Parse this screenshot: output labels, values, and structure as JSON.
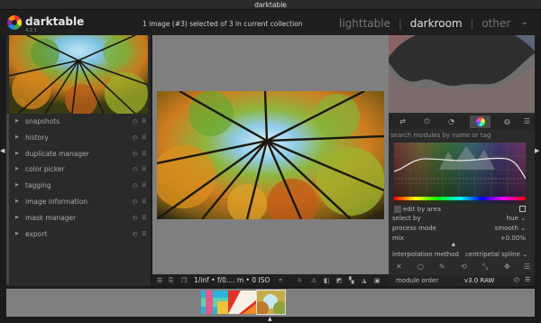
{
  "window": {
    "title": "darktable"
  },
  "app": {
    "name": "darktable",
    "version": "4.2.1"
  },
  "header": {
    "selection_info": "1 image (#3) selected of 3 in current collection",
    "views": [
      "lighttable",
      "darkroom",
      "other"
    ],
    "active_view": "darkroom",
    "separator": "|"
  },
  "left_modules": [
    {
      "label": "snapshots"
    },
    {
      "label": "history"
    },
    {
      "label": "duplicate manager"
    },
    {
      "label": "color picker"
    },
    {
      "label": "tagging"
    },
    {
      "label": "image information"
    },
    {
      "label": "mask manager"
    },
    {
      "label": "export"
    }
  ],
  "right": {
    "search_placeholder": "search modules by name or tag",
    "params": [
      {
        "label": "edit by area",
        "value": ""
      },
      {
        "label": "select by",
        "value": "hue"
      },
      {
        "label": "process mode",
        "value": "smooth"
      },
      {
        "label": "mix",
        "value": "+0.00%"
      },
      {
        "label": "interpolation method",
        "value": "centripetal spline"
      }
    ],
    "module_order_label": "module order",
    "module_order_value": "v3.0 RAW"
  },
  "bottombar": {
    "exposure_info": "1/inf • f/0....  m • 0 ISO"
  },
  "colors": {
    "accent": "#e0e0e0",
    "panel_bg": "#2b2b2b",
    "center_bg": "#7f7f7f"
  }
}
